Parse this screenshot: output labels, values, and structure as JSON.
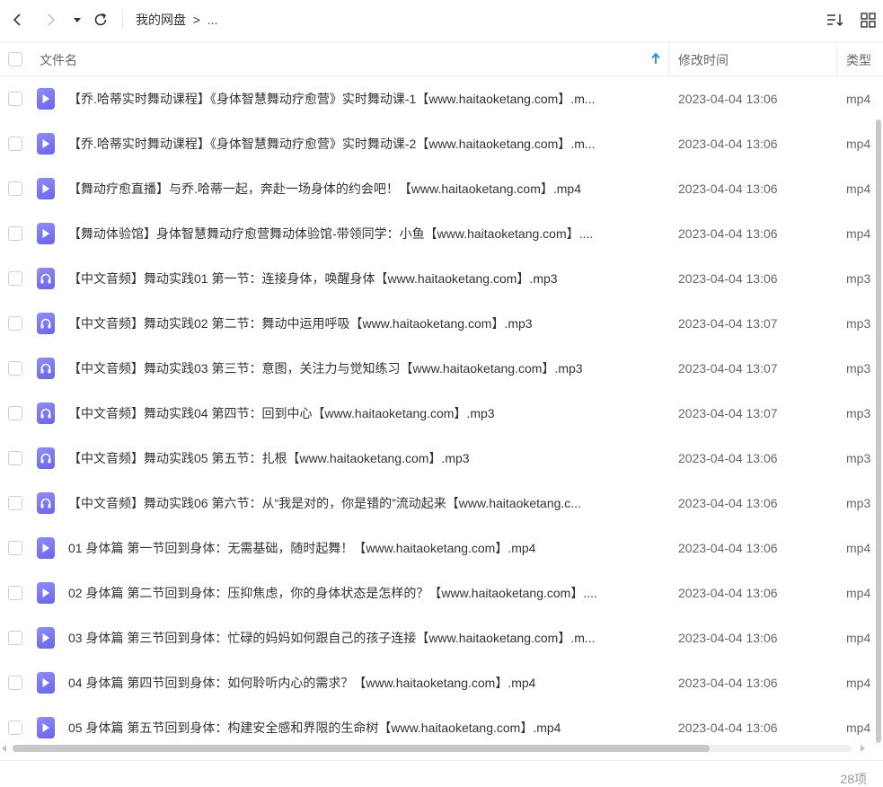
{
  "toolbar": {
    "back_icon": "chevron-left-icon",
    "forward_icon": "chevron-right-icon",
    "history_icon": "caret-down-icon",
    "refresh_icon": "refresh-icon",
    "breadcrumb": {
      "root": "我的网盘",
      "separator": ">",
      "ellipsis": "..."
    },
    "sort_icon": "sort-list-icon",
    "view_icon": "grid-view-icon"
  },
  "header": {
    "name_label": "文件名",
    "time_label": "修改时间",
    "type_label": "类型",
    "sort_direction": "ascending",
    "accent_color": "#1a8cff"
  },
  "files": [
    {
      "icon": "video",
      "name": "【乔.哈蒂实时舞动课程】《身体智慧舞动疗愈营》实时舞动课-1【www.haitaoketang.com】.m...",
      "time": "2023-04-04 13:06",
      "type": "mp4"
    },
    {
      "icon": "video",
      "name": "【乔.哈蒂实时舞动课程】《身体智慧舞动疗愈营》实时舞动课-2【www.haitaoketang.com】.m...",
      "time": "2023-04-04 13:06",
      "type": "mp4"
    },
    {
      "icon": "video",
      "name": "【舞动疗愈直播】与乔.哈蒂一起，奔赴一场身体的约会吧！【www.haitaoketang.com】.mp4",
      "time": "2023-04-04 13:06",
      "type": "mp4"
    },
    {
      "icon": "video",
      "name": "【舞动体验馆】身体智慧舞动疗愈营舞动体验馆-带领同学：小鱼【www.haitaoketang.com】....",
      "time": "2023-04-04 13:06",
      "type": "mp4"
    },
    {
      "icon": "audio",
      "name": "【中文音频】舞动实践01 第一节：连接身体，唤醒身体【www.haitaoketang.com】.mp3",
      "time": "2023-04-04 13:06",
      "type": "mp3"
    },
    {
      "icon": "audio",
      "name": "【中文音频】舞动实践02 第二节：舞动中运用呼吸【www.haitaoketang.com】.mp3",
      "time": "2023-04-04 13:07",
      "type": "mp3"
    },
    {
      "icon": "audio",
      "name": "【中文音频】舞动实践03 第三节：意图，关注力与觉知练习【www.haitaoketang.com】.mp3",
      "time": "2023-04-04 13:07",
      "type": "mp3"
    },
    {
      "icon": "audio",
      "name": "【中文音频】舞动实践04 第四节：回到中心【www.haitaoketang.com】.mp3",
      "time": "2023-04-04 13:07",
      "type": "mp3"
    },
    {
      "icon": "audio",
      "name": "【中文音频】舞动实践05 第五节：扎根【www.haitaoketang.com】.mp3",
      "time": "2023-04-04 13:06",
      "type": "mp3"
    },
    {
      "icon": "audio",
      "name": "【中文音频】舞动实践06 第六节：从“我是对的，你是错的”流动起来【www.haitaoketang.c...",
      "time": "2023-04-04 13:06",
      "type": "mp3"
    },
    {
      "icon": "video",
      "name": "01 身体篇 第一节回到身体：无需基础，随时起舞！【www.haitaoketang.com】.mp4",
      "time": "2023-04-04 13:06",
      "type": "mp4"
    },
    {
      "icon": "video",
      "name": "02 身体篇 第二节回到身体：压抑焦虑，你的身体状态是怎样的？【www.haitaoketang.com】....",
      "time": "2023-04-04 13:06",
      "type": "mp4"
    },
    {
      "icon": "video",
      "name": "03 身体篇 第三节回到身体：忙碌的妈妈如何跟自己的孩子连接【www.haitaoketang.com】.m...",
      "time": "2023-04-04 13:06",
      "type": "mp4"
    },
    {
      "icon": "video",
      "name": "04 身体篇 第四节回到身体：如何聆听内心的需求？【www.haitaoketang.com】.mp4",
      "time": "2023-04-04 13:06",
      "type": "mp4"
    },
    {
      "icon": "video",
      "name": "05 身体篇 第五节回到身体：构建安全感和界限的生命树【www.haitaoketang.com】.mp4",
      "time": "2023-04-04 13:06",
      "type": "mp4"
    }
  ],
  "footer": {
    "count": "28项"
  }
}
